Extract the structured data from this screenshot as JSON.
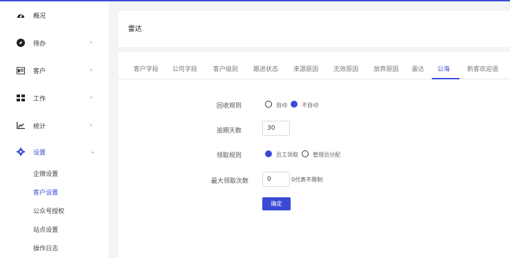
{
  "sidebar": {
    "items": [
      {
        "label": "概况",
        "icon": "dashboard-icon",
        "has_chevron": false
      },
      {
        "label": "待办",
        "icon": "compass-icon",
        "has_chevron": true,
        "chevron": "›"
      },
      {
        "label": "客户",
        "icon": "contact-card-icon",
        "has_chevron": true,
        "chevron": "›"
      },
      {
        "label": "工作",
        "icon": "grid-icon",
        "has_chevron": true,
        "chevron": "›"
      },
      {
        "label": "统计",
        "icon": "line-chart-icon",
        "has_chevron": true,
        "chevron": "›"
      },
      {
        "label": "设置",
        "icon": "gear-icon",
        "has_chevron": true,
        "chevron": "⌄",
        "active": true
      }
    ],
    "sub_items": [
      "企微设置",
      "客户设置",
      "公众号授权",
      "站点设置",
      "操作日志"
    ],
    "active_sub": "客户设置"
  },
  "header": {
    "title": "雷达"
  },
  "tabs": [
    "客户字段",
    "公司字段",
    "客户级别",
    "跟进状态",
    "来源原因",
    "无效原因",
    "放弃原因",
    "雷达",
    "公海",
    "新客欢迎语"
  ],
  "active_tab": "公海",
  "form": {
    "recycle_rule": {
      "label": "回收规则",
      "options": [
        "自动",
        "不自动"
      ],
      "selected": "不自动"
    },
    "overdue_days": {
      "label": "逾期天数",
      "value": "30"
    },
    "claim_rule": {
      "label": "领取规则",
      "options": [
        "员工领取",
        "管理员分配"
      ],
      "selected": "员工领取"
    },
    "max_claims": {
      "label": "最大领取次数",
      "value": "0",
      "hint": "0代表不限制"
    },
    "submit_label": "确定"
  },
  "colors": {
    "accent": "#3b4bd8",
    "background": "#f3f4f6"
  }
}
